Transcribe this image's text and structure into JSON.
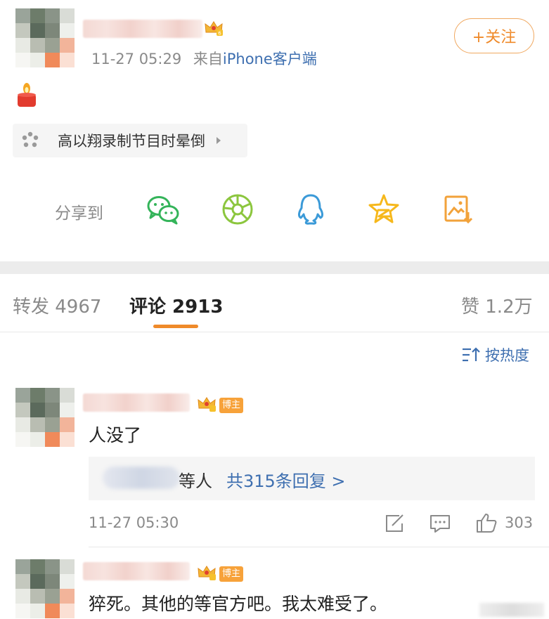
{
  "post": {
    "time": "11-27 05:29",
    "source_prefix": "来自",
    "source_app": "iPhone客户端",
    "follow_label": "+关注",
    "topic_label": "高以翔录制节目时晕倒",
    "level_badge": "6"
  },
  "share": {
    "label": "分享到",
    "icons": [
      "wechat-icon",
      "moments-icon",
      "qq-icon",
      "qzone-icon",
      "save-image-icon"
    ]
  },
  "tabs": {
    "repost": "转发 4967",
    "comments": "评论 2913",
    "likes": "赞 1.2万"
  },
  "sort": {
    "label": "按热度"
  },
  "comments": [
    {
      "badge": "博主",
      "text": "人没了",
      "reply_suffix": "等人",
      "reply_link": "共315条回复 >",
      "time": "11-27 05:30",
      "like_count": "303"
    },
    {
      "badge": "博主",
      "text": "猝死。其他的等官方吧。我太难受了。"
    }
  ],
  "colors": {
    "accent_orange": "#ef8a2a",
    "link_blue": "#3e6fb0",
    "wechat_green": "#34b45a",
    "moments_green": "#8cc63e",
    "qq_blue": "#3b9ad8",
    "qzone_yellow": "#f6b81c",
    "save_orange": "#f2a23a"
  }
}
